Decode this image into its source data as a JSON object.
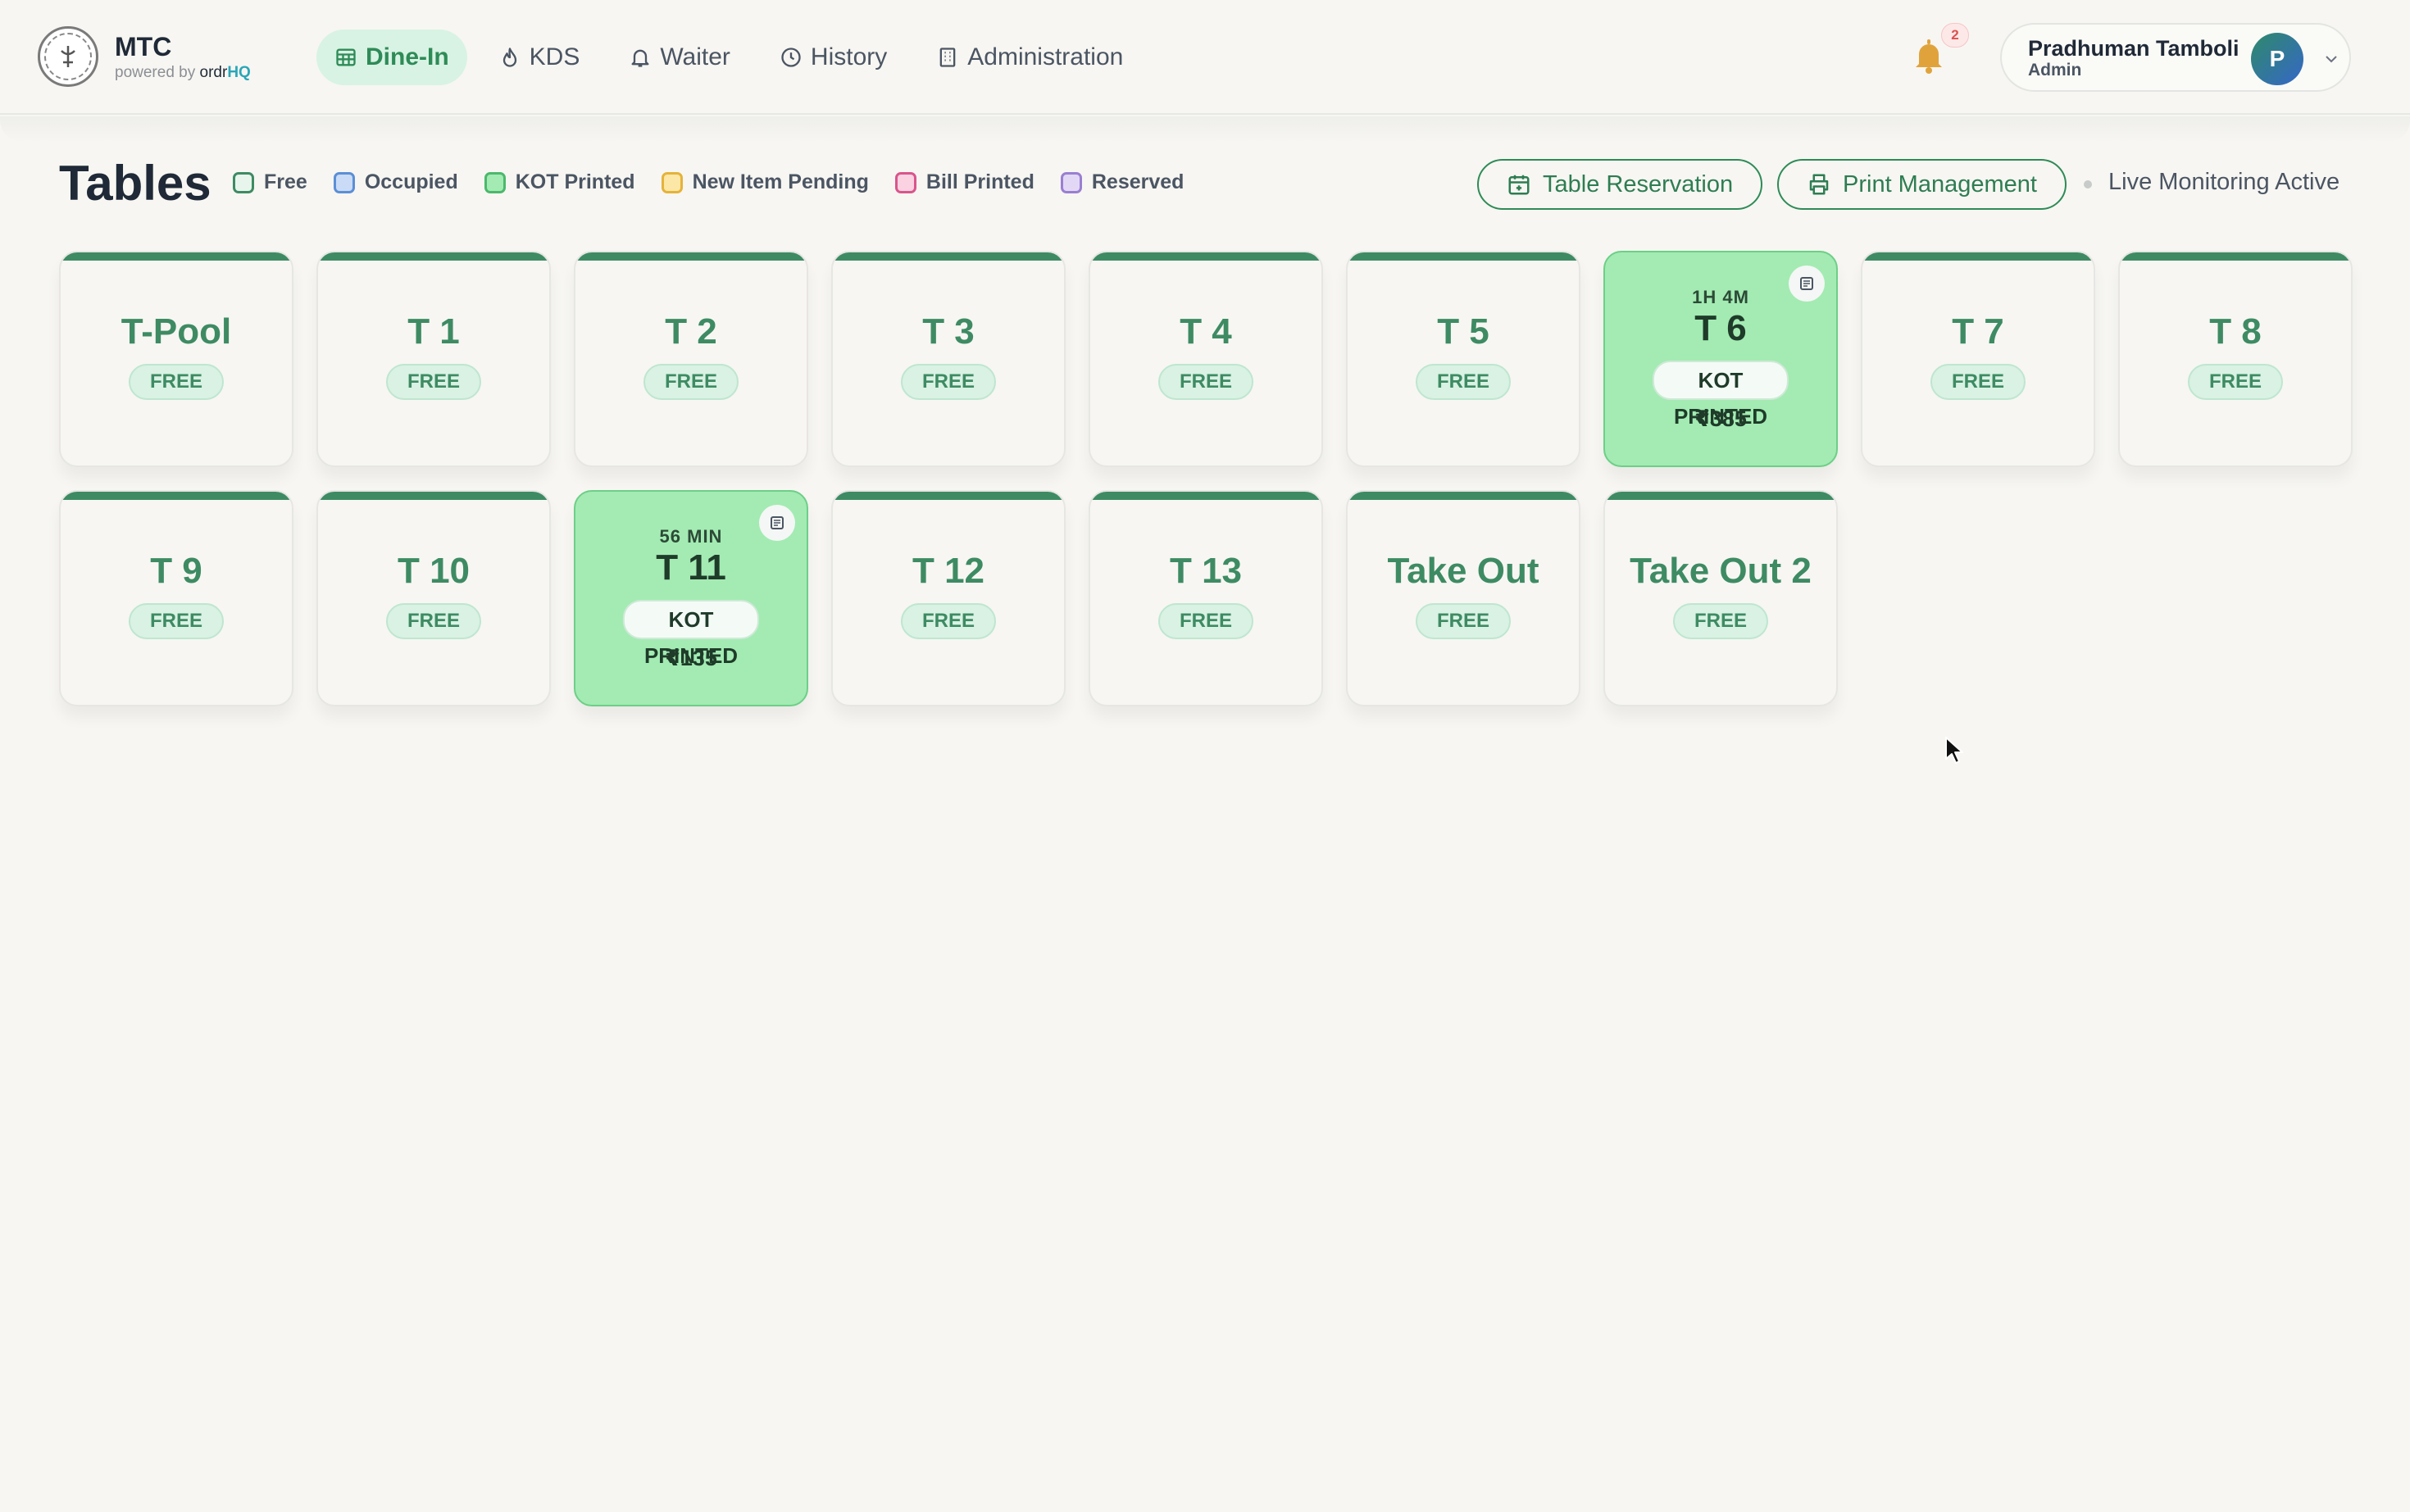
{
  "brand": {
    "name": "MTC",
    "powered_by": "powered by ",
    "powered_ordr": "ordr",
    "powered_hq": "HQ"
  },
  "nav": [
    {
      "label": "Dine-In",
      "icon": "table-grid-icon",
      "active": true
    },
    {
      "label": "KDS",
      "icon": "flame-icon",
      "active": false
    },
    {
      "label": "Waiter",
      "icon": "bell-outline-icon",
      "active": false
    },
    {
      "label": "History",
      "icon": "clock-icon",
      "active": false
    },
    {
      "label": "Administration",
      "icon": "building-icon",
      "active": false
    }
  ],
  "notifications": {
    "count": "2"
  },
  "user": {
    "name": "Pradhuman Tamboli",
    "role": "Admin",
    "initial": "P"
  },
  "page": {
    "title": "Tables"
  },
  "legend": [
    {
      "label": "Free",
      "color": "#3e8b63",
      "fill": "#e8f5ed"
    },
    {
      "label": "Occupied",
      "color": "#5b8fd6",
      "fill": "#c9dbf6"
    },
    {
      "label": "KOT Printed",
      "color": "#4cb86c",
      "fill": "#a3ebb3"
    },
    {
      "label": "New Item Pending",
      "color": "#e5b33a",
      "fill": "#fde7a6"
    },
    {
      "label": "Bill Printed",
      "color": "#d9558c",
      "fill": "#fad2e2"
    },
    {
      "label": "Reserved",
      "color": "#9a7fd1",
      "fill": "#e2d8f5"
    }
  ],
  "actions": {
    "reservation": "Table Reservation",
    "print": "Print Management",
    "live": "Live Monitoring Active"
  },
  "tables": [
    {
      "name": "T-Pool",
      "status": "FREE"
    },
    {
      "name": "T 1",
      "status": "FREE"
    },
    {
      "name": "T 2",
      "status": "FREE"
    },
    {
      "name": "T 3",
      "status": "FREE"
    },
    {
      "name": "T 4",
      "status": "FREE"
    },
    {
      "name": "T 5",
      "status": "FREE"
    },
    {
      "name": "T 6",
      "status": "KOT PRINTED",
      "time": "1H 4M",
      "amount": "₹385"
    },
    {
      "name": "T 7",
      "status": "FREE"
    },
    {
      "name": "T 8",
      "status": "FREE"
    },
    {
      "name": "T 9",
      "status": "FREE"
    },
    {
      "name": "T 10",
      "status": "FREE"
    },
    {
      "name": "T 11",
      "status": "KOT PRINTED",
      "time": "56 MIN",
      "amount": "₹135"
    },
    {
      "name": "T 12",
      "status": "FREE"
    },
    {
      "name": "T 13",
      "status": "FREE"
    },
    {
      "name": "Take Out",
      "status": "FREE"
    },
    {
      "name": "Take Out 2",
      "status": "FREE"
    }
  ]
}
